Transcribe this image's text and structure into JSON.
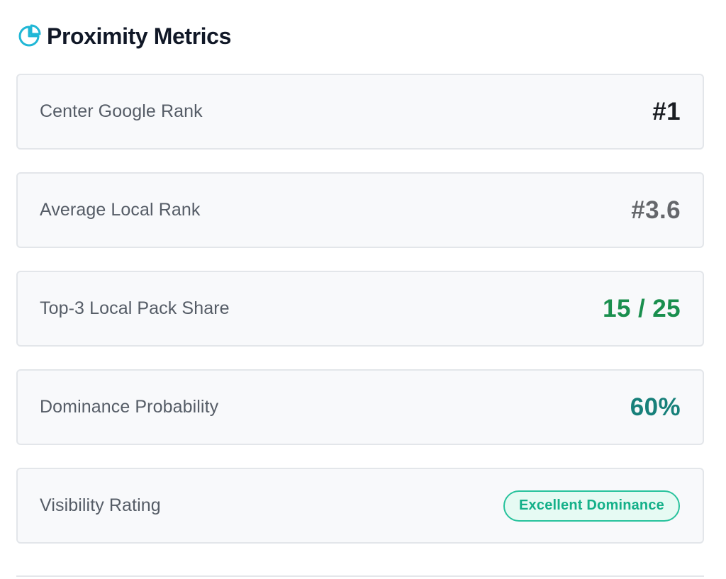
{
  "header": {
    "title": "Proximity Metrics",
    "icon": "pie-chart-icon"
  },
  "colors": {
    "accent": "#20b7d6",
    "dark_value": "#1a1d22",
    "muted_value": "#65676b",
    "positive_value": "#1a8f4e",
    "teal_value": "#17807a",
    "badge_text": "#14b089",
    "badge_border": "#27c29c",
    "badge_bg": "#e6faf3"
  },
  "metrics": [
    {
      "label": "Center Google Rank",
      "value": "#1"
    },
    {
      "label": "Average Local Rank",
      "value": "#3.6"
    },
    {
      "label": "Top-3 Local Pack Share",
      "value": "15 / 25"
    },
    {
      "label": "Dominance Probability",
      "value": "60%"
    },
    {
      "label": "Visibility Rating",
      "badge": "Excellent Dominance"
    }
  ]
}
